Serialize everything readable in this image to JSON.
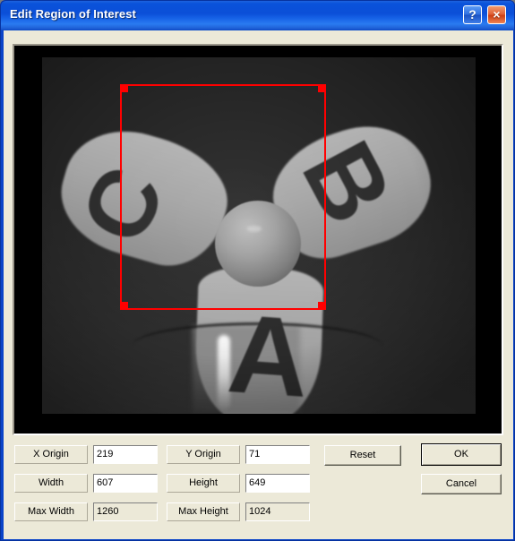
{
  "window": {
    "title": "Edit Region of Interest",
    "help_button": "?",
    "close_button": "×",
    "frame_color": "#0a43c8",
    "dialog_background": "#ece9d8"
  },
  "viewer": {
    "name": "roi-image-preview",
    "background_color": "#000000",
    "image_description": "Grayscale photo of a three-blade fan with letters A, B and C painted on the blades",
    "blade_letters": [
      "A",
      "B",
      "C"
    ],
    "roi_overlay": {
      "color": "#ff0000",
      "handles": 4
    }
  },
  "fields": [
    {
      "label": "X Origin",
      "value": "219",
      "disabled": false
    },
    {
      "label": "Y Origin",
      "value": "71",
      "disabled": false
    },
    {
      "label": "Width",
      "value": "607",
      "disabled": false
    },
    {
      "label": "Height",
      "value": "649",
      "disabled": false
    },
    {
      "label": "Max Width",
      "value": "1260",
      "disabled": true
    },
    {
      "label": "Max Height",
      "value": "1024",
      "disabled": true
    }
  ],
  "buttons": {
    "reset": "Reset",
    "ok": "OK",
    "cancel": "Cancel"
  }
}
